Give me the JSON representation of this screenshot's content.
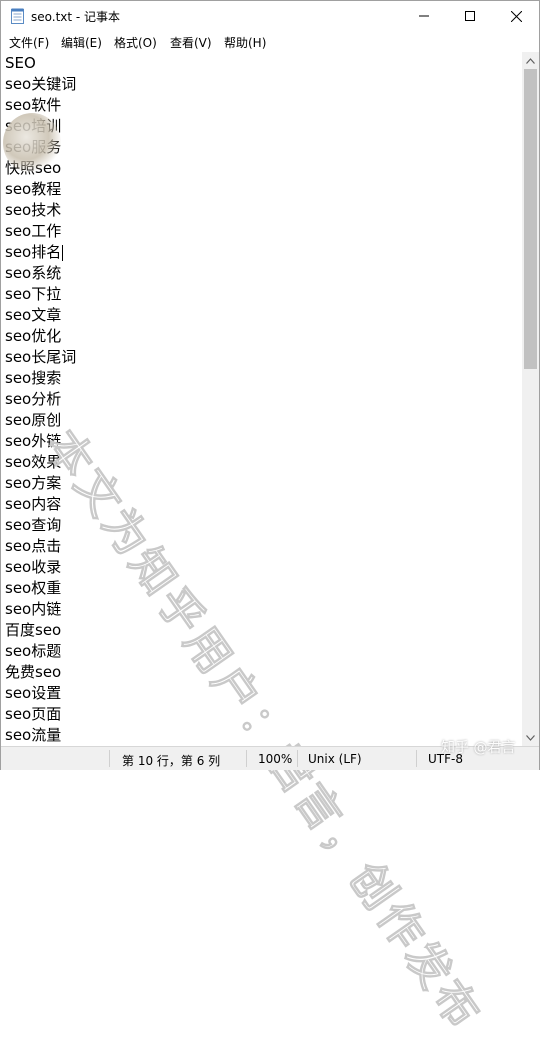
{
  "window": {
    "title": "seo.txt - 记事本",
    "minimize_glyph": "—",
    "maximize_glyph": "☐",
    "close_glyph": "✕"
  },
  "menu": {
    "items": [
      "文件(F)",
      "编辑(E)",
      "格式(O)",
      "查看(V)",
      "帮助(H)"
    ]
  },
  "editor": {
    "lines": [
      "SEO",
      "seo关键词",
      "seo软件",
      "seo培训",
      "seo服务",
      "快照seo",
      "seo教程",
      "seo技术",
      "seo工作",
      "seo排名",
      "seo系统",
      "seo下拉",
      "seo文章",
      "seo优化",
      "seo长尾词",
      "seo搜索",
      "seo分析",
      "seo原创",
      "seo外链",
      "seo效果",
      "seo方案",
      "seo内容",
      "seo查询",
      "seo点击",
      "seo收录",
      "seo权重",
      "seo内链",
      "百度seo",
      "seo标题",
      "免费seo",
      "seo设置",
      "seo页面",
      "seo流量"
    ],
    "caret_line_index": 9
  },
  "statusbar": {
    "position": "第 10 行，第 6 列",
    "zoom": "100%",
    "line_ending": "Unix (LF)",
    "encoding": "UTF-8"
  },
  "watermark": {
    "text": "本文为知乎用户：君言，创作发布",
    "site": "知乎 @君言"
  },
  "icons": {
    "app": "notepad-icon",
    "scroll_up": "chevron-up-icon",
    "scroll_down": "chevron-down-icon"
  }
}
